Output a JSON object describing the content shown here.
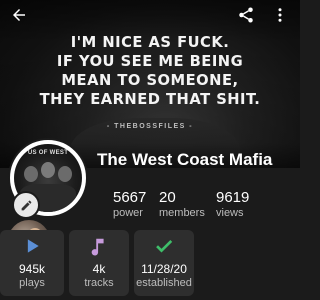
{
  "cover": {
    "quote_lines": [
      "I'M NICE AS FUCK.",
      "IF YOU SEE ME BEING",
      "MEAN TO SOMEONE,",
      "THEY EARNED THAT SHIT."
    ],
    "source": "- THEBOSSFILES -"
  },
  "toolbar": {
    "back_icon": "arrow-left-icon",
    "share_icon": "share-icon",
    "more_icon": "more-vert-icon"
  },
  "profile": {
    "avatar_text": "US OF WEST",
    "name": "The West Coast Mafia",
    "stats": [
      {
        "value": "5667",
        "label": "power"
      },
      {
        "value": "20",
        "label": "members"
      },
      {
        "value": "9619",
        "label": "views"
      }
    ]
  },
  "cards": [
    {
      "value": "945k",
      "label": "plays",
      "icon": "play-icon",
      "color": "#5b8fd6"
    },
    {
      "value": "4k",
      "label": "tracks",
      "icon": "music-note-icon",
      "color": "#c79bdc"
    },
    {
      "value": "11/28/20",
      "label": "established",
      "icon": "check-icon",
      "color": "#3fbf6a"
    }
  ]
}
